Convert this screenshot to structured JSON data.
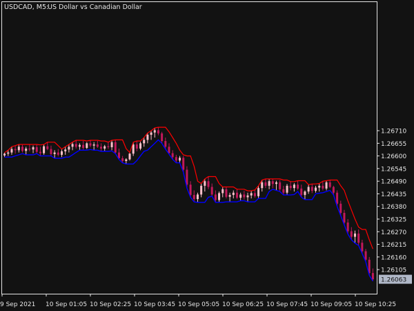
{
  "chart_data": {
    "type": "candlestick",
    "symbol": "USDCAD, M5:",
    "description": "US Dollar vs Canadian Dollar",
    "ylim": [
      1.26,
      1.2727
    ],
    "y_ticks": [
      "1.26710",
      "1.26655",
      "1.26600",
      "1.26545",
      "1.26490",
      "1.26435",
      "1.26380",
      "1.26325",
      "1.26270",
      "1.26215",
      "1.26160",
      "1.26105"
    ],
    "y_tick_values": [
      1.2671,
      1.26655,
      1.266,
      1.26545,
      1.2649,
      1.26435,
      1.2638,
      1.26325,
      1.2627,
      1.26215,
      1.2616,
      1.26105
    ],
    "x_ticks": [
      "9 Sep 2021",
      "10 Sep 01:05",
      "10 Sep 02:25",
      "10 Sep 03:45",
      "10 Sep 05:05",
      "10 Sep 06:25",
      "10 Sep 07:45",
      "10 Sep 09:05",
      "10 Sep 10:25"
    ],
    "current_price": "1.26063",
    "colors": {
      "background": "#121212",
      "axis": "#e6e6e6",
      "bull": "#ffc0cb",
      "bear": "#c2185b",
      "doji": "#2e7d32",
      "upper_line": "#ff0000",
      "lower_line": "#0000ff",
      "price_label_bg": "#b0b8c8"
    },
    "candles": [
      [
        1.26602,
        1.26614,
        1.26595,
        1.2661
      ],
      [
        1.2661,
        1.26625,
        1.266,
        1.26615
      ],
      [
        1.26615,
        1.2664,
        1.26605,
        1.2663
      ],
      [
        1.2663,
        1.26645,
        1.2661,
        1.26625
      ],
      [
        1.26625,
        1.2665,
        1.26615,
        1.2664
      ],
      [
        1.2664,
        1.26648,
        1.26615,
        1.26622
      ],
      [
        1.26622,
        1.2664,
        1.26605,
        1.26632
      ],
      [
        1.26632,
        1.2665,
        1.2662,
        1.26628
      ],
      [
        1.26628,
        1.26645,
        1.26612,
        1.26638
      ],
      [
        1.26638,
        1.26648,
        1.2661,
        1.26618
      ],
      [
        1.26618,
        1.2664,
        1.266,
        1.26612
      ],
      [
        1.26612,
        1.2665,
        1.26605,
        1.26642
      ],
      [
        1.26642,
        1.2666,
        1.26625,
        1.2663
      ],
      [
        1.2663,
        1.26645,
        1.266,
        1.26608
      ],
      [
        1.26608,
        1.26625,
        1.2659,
        1.26615
      ],
      [
        1.26615,
        1.2663,
        1.26598,
        1.26605
      ],
      [
        1.26605,
        1.26628,
        1.26595,
        1.2662
      ],
      [
        1.2662,
        1.2664,
        1.26605,
        1.26628
      ],
      [
        1.26628,
        1.2665,
        1.26615,
        1.2664
      ],
      [
        1.2664,
        1.2666,
        1.26625,
        1.26652
      ],
      [
        1.26652,
        1.26668,
        1.26632,
        1.2664
      ],
      [
        1.2664,
        1.26655,
        1.26625,
        1.26648
      ],
      [
        1.26648,
        1.26665,
        1.26628,
        1.26635
      ],
      [
        1.26635,
        1.2666,
        1.2663,
        1.26655
      ],
      [
        1.26655,
        1.26668,
        1.26638,
        1.26645
      ],
      [
        1.26645,
        1.2666,
        1.26625,
        1.2665
      ],
      [
        1.2665,
        1.26665,
        1.26635,
        1.2664
      ],
      [
        1.2664,
        1.26655,
        1.2662,
        1.26632
      ],
      [
        1.26632,
        1.26648,
        1.26622,
        1.26642
      ],
      [
        1.26642,
        1.2666,
        1.2663,
        1.26638
      ],
      [
        1.26638,
        1.26668,
        1.26625,
        1.2666
      ],
      [
        1.2666,
        1.2667,
        1.2661,
        1.26615
      ],
      [
        1.26615,
        1.26632,
        1.26585,
        1.2659
      ],
      [
        1.2659,
        1.266,
        1.2657,
        1.26578
      ],
      [
        1.26578,
        1.2659,
        1.26565,
        1.26585
      ],
      [
        1.26585,
        1.26615,
        1.2658,
        1.2661
      ],
      [
        1.2661,
        1.2666,
        1.266,
        1.2665
      ],
      [
        1.2665,
        1.26665,
        1.2662,
        1.26632
      ],
      [
        1.26632,
        1.26662,
        1.26625,
        1.26655
      ],
      [
        1.26655,
        1.2668,
        1.2664,
        1.2667
      ],
      [
        1.2667,
        1.267,
        1.26655,
        1.26692
      ],
      [
        1.26692,
        1.2671,
        1.2667,
        1.26702
      ],
      [
        1.26702,
        1.26722,
        1.2668,
        1.26712
      ],
      [
        1.26712,
        1.26725,
        1.2669,
        1.26698
      ],
      [
        1.26698,
        1.26705,
        1.26655,
        1.26665
      ],
      [
        1.26665,
        1.2668,
        1.2663,
        1.2664
      ],
      [
        1.2664,
        1.26655,
        1.26608,
        1.26612
      ],
      [
        1.26612,
        1.26625,
        1.26585,
        1.26595
      ],
      [
        1.26595,
        1.26605,
        1.2657,
        1.2658
      ],
      [
        1.2658,
        1.266,
        1.2657,
        1.26592
      ],
      [
        1.26592,
        1.266,
        1.2653,
        1.2654
      ],
      [
        1.2654,
        1.26555,
        1.2646,
        1.26475
      ],
      [
        1.26475,
        1.2649,
        1.2642,
        1.2643
      ],
      [
        1.2643,
        1.2645,
        1.264,
        1.26412
      ],
      [
        1.26412,
        1.2644,
        1.26398,
        1.26432
      ],
      [
        1.26432,
        1.2648,
        1.2642,
        1.2647
      ],
      [
        1.2647,
        1.265,
        1.26445,
        1.2649
      ],
      [
        1.2649,
        1.2651,
        1.26455,
        1.26465
      ],
      [
        1.26465,
        1.2648,
        1.26425,
        1.26432
      ],
      [
        1.26432,
        1.2645,
        1.26398,
        1.26408
      ],
      [
        1.26408,
        1.26445,
        1.264,
        1.26438
      ],
      [
        1.26438,
        1.26465,
        1.2642,
        1.26455
      ],
      [
        1.26455,
        1.26465,
        1.26415,
        1.26422
      ],
      [
        1.26422,
        1.2644,
        1.264,
        1.2643
      ],
      [
        1.2643,
        1.2645,
        1.26415,
        1.2644
      ],
      [
        1.2644,
        1.26455,
        1.26412,
        1.26418
      ],
      [
        1.26418,
        1.2644,
        1.26405,
        1.26432
      ],
      [
        1.26432,
        1.26448,
        1.2641,
        1.2642
      ],
      [
        1.2642,
        1.2644,
        1.264,
        1.26428
      ],
      [
        1.26428,
        1.26448,
        1.26415,
        1.26438
      ],
      [
        1.26438,
        1.26452,
        1.26418,
        1.26425
      ],
      [
        1.26425,
        1.2647,
        1.26415,
        1.2646
      ],
      [
        1.2646,
        1.26495,
        1.26445,
        1.26485
      ],
      [
        1.26485,
        1.265,
        1.2646,
        1.2647
      ],
      [
        1.2647,
        1.26498,
        1.26455,
        1.2649
      ],
      [
        1.2649,
        1.265,
        1.2646,
        1.26478
      ],
      [
        1.26478,
        1.26492,
        1.2645,
        1.26485
      ],
      [
        1.26485,
        1.26495,
        1.26445,
        1.26455
      ],
      [
        1.26455,
        1.2647,
        1.2643,
        1.2644
      ],
      [
        1.2644,
        1.26478,
        1.26432,
        1.2647
      ],
      [
        1.2647,
        1.26488,
        1.2645,
        1.2646
      ],
      [
        1.2646,
        1.26482,
        1.26445,
        1.26475
      ],
      [
        1.26475,
        1.26492,
        1.26452,
        1.26458
      ],
      [
        1.26458,
        1.26475,
        1.2642,
        1.2643
      ],
      [
        1.2643,
        1.2645,
        1.2641,
        1.26445
      ],
      [
        1.26445,
        1.26475,
        1.26435,
        1.26465
      ],
      [
        1.26465,
        1.26478,
        1.26438,
        1.26448
      ],
      [
        1.26448,
        1.2647,
        1.2644,
        1.26462
      ],
      [
        1.26462,
        1.2648,
        1.26445,
        1.2647
      ],
      [
        1.2647,
        1.2649,
        1.2645,
        1.26458
      ],
      [
        1.26458,
        1.26492,
        1.2645,
        1.26485
      ],
      [
        1.26485,
        1.26495,
        1.2646,
        1.26465
      ],
      [
        1.26465,
        1.2647,
        1.2643,
        1.2644
      ],
      [
        1.2644,
        1.2645,
        1.2638,
        1.26392
      ],
      [
        1.26392,
        1.26405,
        1.2634,
        1.26352
      ],
      [
        1.26352,
        1.26365,
        1.263,
        1.2631
      ],
      [
        1.2631,
        1.26325,
        1.2626,
        1.26272
      ],
      [
        1.26272,
        1.2629,
        1.26235,
        1.26248
      ],
      [
        1.26248,
        1.26275,
        1.2622,
        1.26262
      ],
      [
        1.26262,
        1.2628,
        1.2621,
        1.26222
      ],
      [
        1.26222,
        1.26235,
        1.26175,
        1.26185
      ],
      [
        1.26185,
        1.26195,
        1.2614,
        1.26148
      ],
      [
        1.26148,
        1.2616,
        1.2608,
        1.2609
      ],
      [
        1.2609,
        1.2611,
        1.26055,
        1.26063
      ]
    ]
  }
}
